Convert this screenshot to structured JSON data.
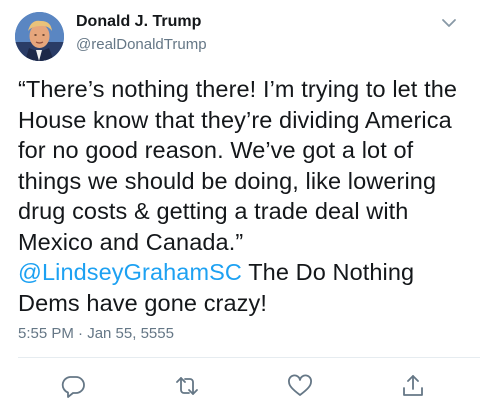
{
  "tweet": {
    "author": {
      "name": "Donald J. Trump",
      "handle": "@realDonaldTrump"
    },
    "text_part1": "“There’s nothing there! I’m trying to let the House know that they’re dividing America for no good reason. We’ve got a lot of things we should be doing, like lowering drug costs & getting a trade deal with Mexico and Canada.” ",
    "mention": "@LindseyGrahamSC",
    "text_part2": " The Do Nothing Dems have gone crazy!",
    "timestamp": "5:55 PM · Jan 55, 5555"
  },
  "icons": {
    "caret": "chevron-down-icon",
    "reply": "reply-icon",
    "retweet": "retweet-icon",
    "like": "heart-icon",
    "share": "share-icon"
  },
  "colors": {
    "text": "#14171a",
    "secondary": "#657786",
    "link": "#1da1f2",
    "divider": "#e6ecf0"
  }
}
